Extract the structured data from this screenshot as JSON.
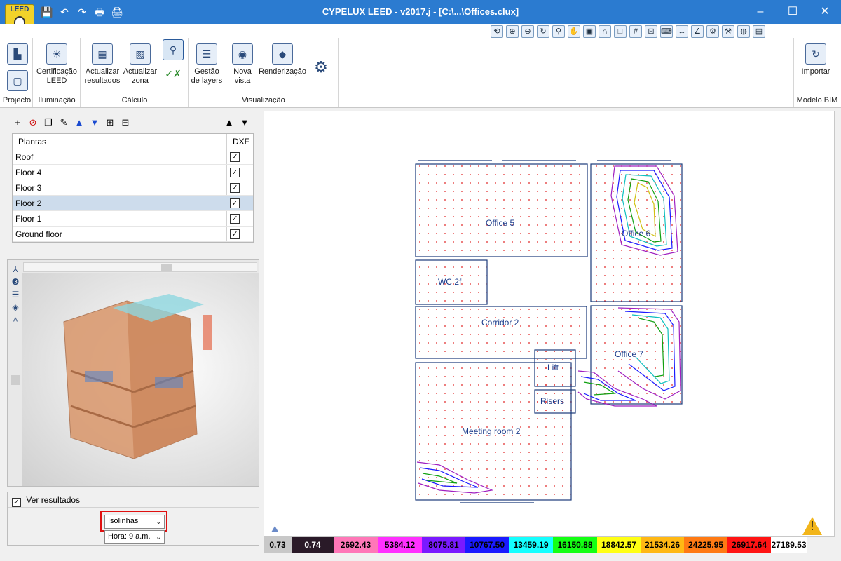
{
  "window": {
    "title": "CYPELUX LEED - v2017.j - [C:\\...\\Offices.clux]",
    "minimize": "–",
    "maximize": "☐",
    "close": "✕"
  },
  "app": {
    "logo_text": "LEED"
  },
  "quick_access": {
    "save": "💾",
    "undo": "↶",
    "redo": "↷",
    "print": "🖶",
    "print_preview": "🖨"
  },
  "ribbon": {
    "groups": [
      {
        "label": "Projecto"
      },
      {
        "label": "Iluminação"
      },
      {
        "label": "Cálculo"
      },
      {
        "label": "Visualização"
      },
      {
        "label": "Modelo BIM"
      }
    ],
    "buttons": {
      "project_view": "",
      "project_view2": "",
      "certificacao": "Certificação LEED",
      "actualizar_resultados": "Actualizar resultados",
      "actualizar_zona": "Actualizar zona",
      "gestao_layers": "Gestão de layers",
      "nova_vista": "Nova vista",
      "renderizacao": "Renderização",
      "importar": "Importar"
    }
  },
  "floors": {
    "headers": {
      "name": "Plantas",
      "dxf": "DXF"
    },
    "rows": [
      {
        "name": "Roof",
        "dxf": true
      },
      {
        "name": "Floor 4",
        "dxf": true
      },
      {
        "name": "Floor 3",
        "dxf": true
      },
      {
        "name": "Floor 2",
        "dxf": true,
        "selected": true
      },
      {
        "name": "Floor 1",
        "dxf": true
      },
      {
        "name": "Ground floor",
        "dxf": true
      }
    ]
  },
  "results": {
    "show_label": "Ver resultados",
    "show_checked": true,
    "mode_value": "Isolinhas",
    "time_value": "Hora: 9 a.m."
  },
  "plan": {
    "rooms": [
      "Office 5",
      "Office 6",
      "WC 2f",
      "Corridor 2",
      "Office 7",
      "Lift",
      "Risers",
      "Meeting room 2"
    ]
  },
  "scale": {
    "values": [
      "0.73",
      "0.74",
      "2692.43",
      "5384.12",
      "8075.81",
      "10767.50",
      "13459.19",
      "16150.88",
      "18842.57",
      "21534.26",
      "24225.95",
      "26917.64",
      "27189.53"
    ],
    "colors": [
      "#c8c8c8",
      "#2a1a28",
      "#ff77b8",
      "#ff30ff",
      "#7a1aff",
      "#1a1aff",
      "#14ffff",
      "#14ff14",
      "#ffff14",
      "#ffb814",
      "#ff7a14",
      "#ff1414",
      "#ffffff"
    ]
  }
}
